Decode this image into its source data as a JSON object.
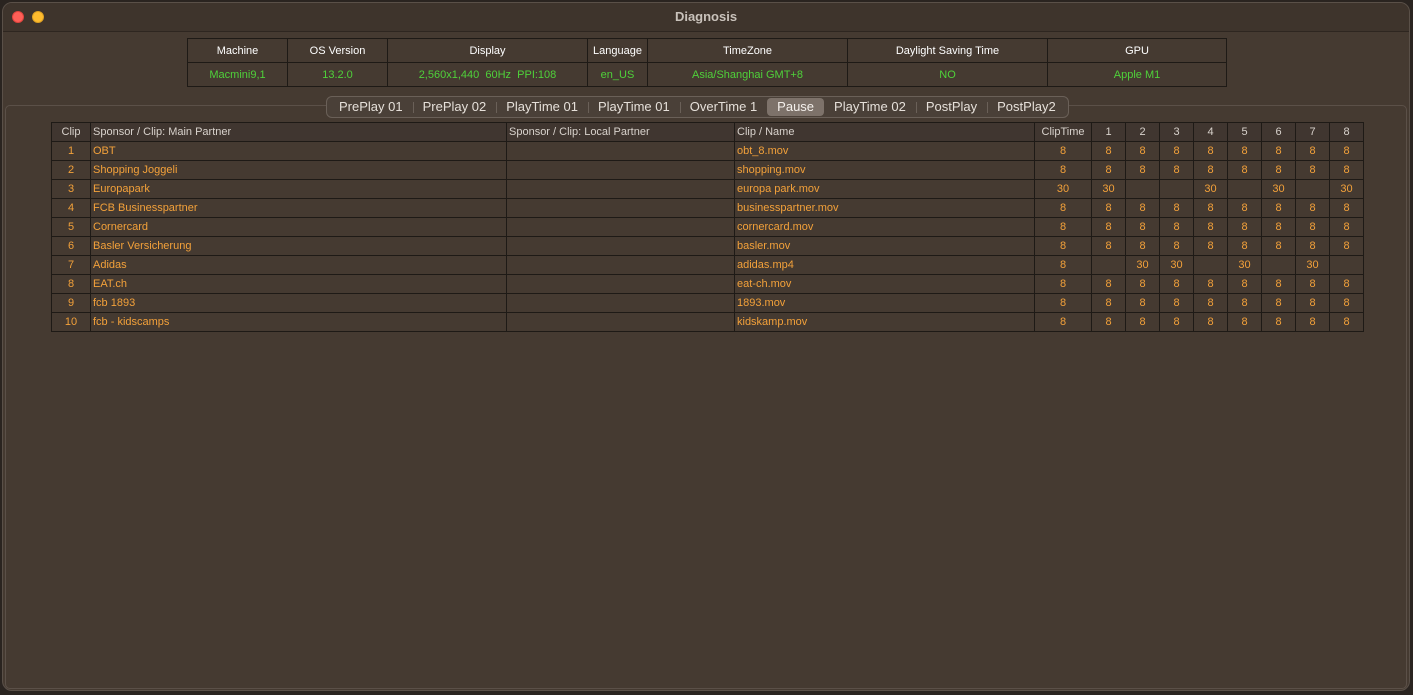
{
  "window": {
    "title": "Diagnosis"
  },
  "info": {
    "headers": [
      "Machine",
      "OS Version",
      "Display",
      "Language",
      "TimeZone",
      "Daylight Saving Time",
      "GPU"
    ],
    "values": [
      "Macmini9,1",
      "13.2.0",
      "2,560x1,440  60Hz  PPI:108",
      "en_US",
      "Asia/Shanghai GMT+8",
      "NO",
      "Apple M1"
    ]
  },
  "tabs": [
    {
      "label": "PrePlay 01"
    },
    {
      "label": "PrePlay 02"
    },
    {
      "label": "PlayTime 01"
    },
    {
      "label": "PlayTime 01"
    },
    {
      "label": "OverTime 1"
    },
    {
      "label": "Pause",
      "selected": true
    },
    {
      "label": "PlayTime 02"
    },
    {
      "label": "PostPlay"
    },
    {
      "label": "PostPlay2"
    }
  ],
  "table": {
    "columns": [
      "Clip",
      "Sponsor / Clip: Main Partner",
      "Sponsor / Clip: Local Partner",
      "Clip / Name",
      "ClipTime",
      "1",
      "2",
      "3",
      "4",
      "5",
      "6",
      "7",
      "8"
    ],
    "rows": [
      [
        "1",
        "OBT",
        "",
        "obt_8.mov",
        "8",
        "8",
        "8",
        "8",
        "8",
        "8",
        "8",
        "8",
        "8"
      ],
      [
        "2",
        "Shopping Joggeli",
        "",
        "shopping.mov",
        "8",
        "8",
        "8",
        "8",
        "8",
        "8",
        "8",
        "8",
        "8"
      ],
      [
        "3",
        "Europapark",
        "",
        "europa park.mov",
        "30",
        "30",
        "",
        "",
        "30",
        "",
        "30",
        "",
        "30"
      ],
      [
        "4",
        "FCB Businesspartner",
        "",
        "businesspartner.mov",
        "8",
        "8",
        "8",
        "8",
        "8",
        "8",
        "8",
        "8",
        "8"
      ],
      [
        "5",
        "Cornercard",
        "",
        "cornercard.mov",
        "8",
        "8",
        "8",
        "8",
        "8",
        "8",
        "8",
        "8",
        "8"
      ],
      [
        "6",
        "Basler Versicherung",
        "",
        "basler.mov",
        "8",
        "8",
        "8",
        "8",
        "8",
        "8",
        "8",
        "8",
        "8"
      ],
      [
        "7",
        "Adidas",
        "",
        "adidas.mp4",
        "8",
        "",
        "30",
        "30",
        "",
        "30",
        "",
        "30",
        ""
      ],
      [
        "8",
        "EAT.ch",
        "",
        "eat-ch.mov",
        "8",
        "8",
        "8",
        "8",
        "8",
        "8",
        "8",
        "8",
        "8"
      ],
      [
        "9",
        "fcb 1893",
        "",
        "1893.mov",
        "8",
        "8",
        "8",
        "8",
        "8",
        "8",
        "8",
        "8",
        "8"
      ],
      [
        "10",
        "fcb - kidscamps",
        "",
        "kidskamp.mov",
        "8",
        "8",
        "8",
        "8",
        "8",
        "8",
        "8",
        "8",
        "8"
      ]
    ]
  },
  "colors": {
    "value_green": "#4fd13a",
    "value_orange": "#f3a13a",
    "background": "#453a31"
  }
}
